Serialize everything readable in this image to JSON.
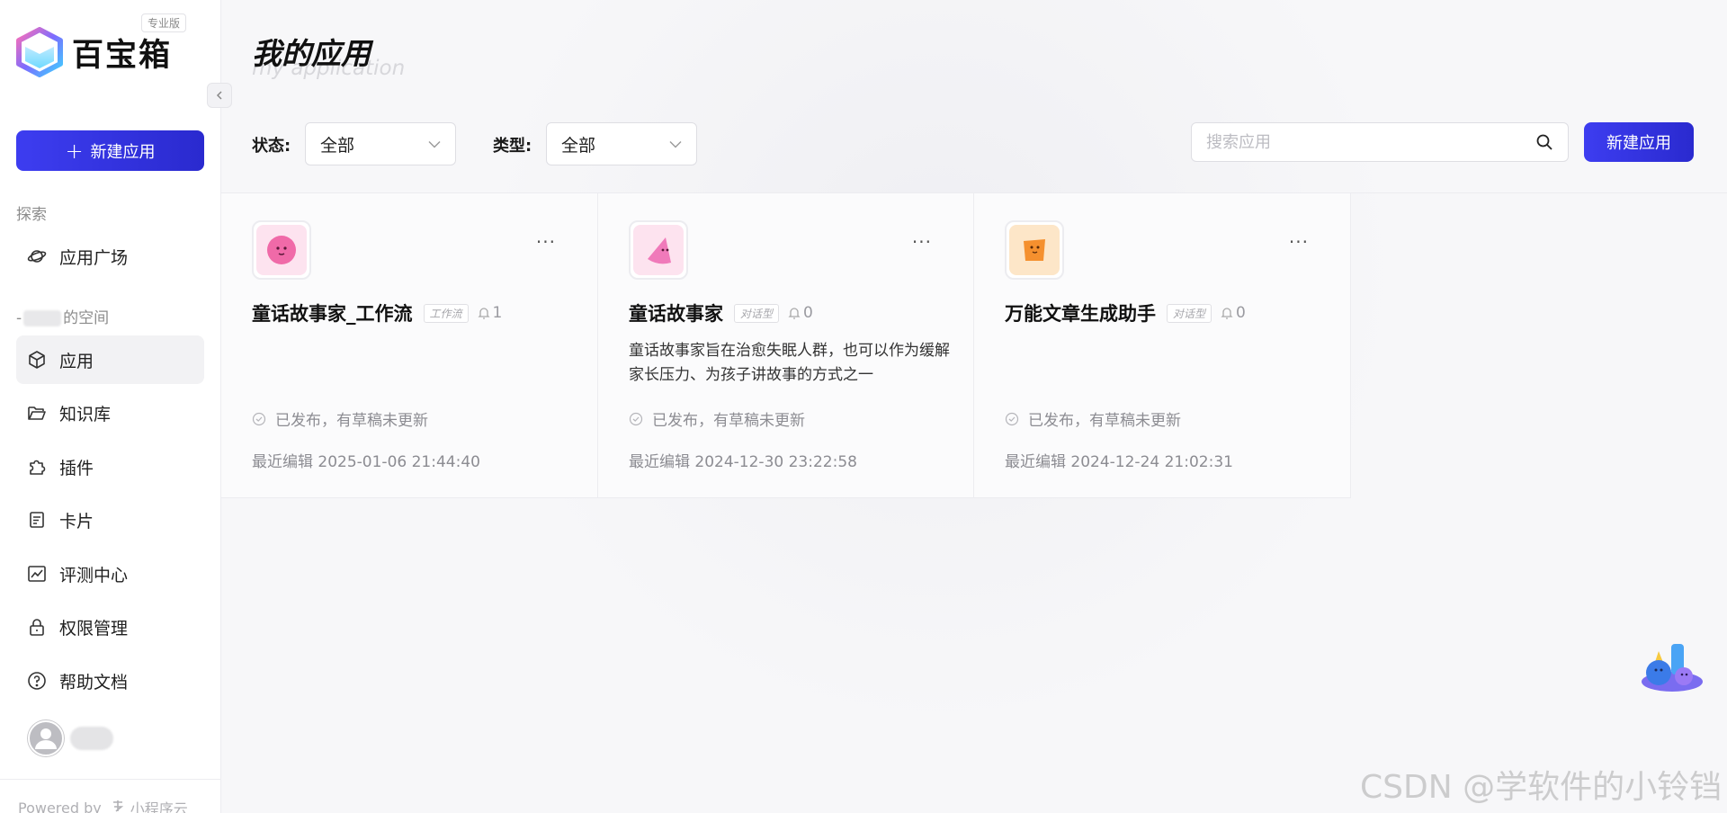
{
  "sidebar": {
    "logo_text": "百宝箱",
    "edition_badge": "专业版",
    "new_app_label": "新建应用",
    "explore_label": "探索",
    "app_plaza_label": "应用广场",
    "space_prefix": "-",
    "space_suffix": "的空间",
    "items": [
      {
        "label": "应用",
        "icon": "cube-icon"
      },
      {
        "label": "知识库",
        "icon": "folder-icon"
      },
      {
        "label": "插件",
        "icon": "puzzle-icon"
      },
      {
        "label": "卡片",
        "icon": "card-icon"
      },
      {
        "label": "评测中心",
        "icon": "chart-icon"
      },
      {
        "label": "权限管理",
        "icon": "lock-icon"
      },
      {
        "label": "帮助文档",
        "icon": "help-icon"
      }
    ],
    "powered_by": "Powered by",
    "powered_brand": "小程序云"
  },
  "header": {
    "title": "我的应用",
    "subtitle": "my application"
  },
  "filters": {
    "status_label": "状态:",
    "status_value": "全部",
    "type_label": "类型:",
    "type_value": "全部"
  },
  "search": {
    "placeholder": "搜索应用"
  },
  "new_app_button": "新建应用",
  "cards": [
    {
      "title": "童话故事家_工作流",
      "type_tag": "工作流",
      "count": "1",
      "description": "",
      "status": "已发布，有草稿未更新",
      "last_edit": "最近编辑 2025-01-06 21:44:40",
      "icon_color": "#f27ab0"
    },
    {
      "title": "童话故事家",
      "type_tag": "对话型",
      "count": "0",
      "description": "童话故事家旨在治愈失眠人群，也可以作为缓解家长压力、为孩子讲故事的方式之一",
      "status": "已发布，有草稿未更新",
      "last_edit": "最近编辑 2024-12-30 23:22:58",
      "icon_color": "#f07aba"
    },
    {
      "title": "万能文章生成助手",
      "type_tag": "对话型",
      "count": "0",
      "description": "",
      "status": "已发布，有草稿未更新",
      "last_edit": "最近编辑 2024-12-24 21:02:31",
      "icon_color": "#f59a3c"
    }
  ],
  "watermark": "CSDN @学软件的小铃铛",
  "colors": {
    "accent": "#3434e0",
    "active_bg": "#f2f2f4"
  }
}
